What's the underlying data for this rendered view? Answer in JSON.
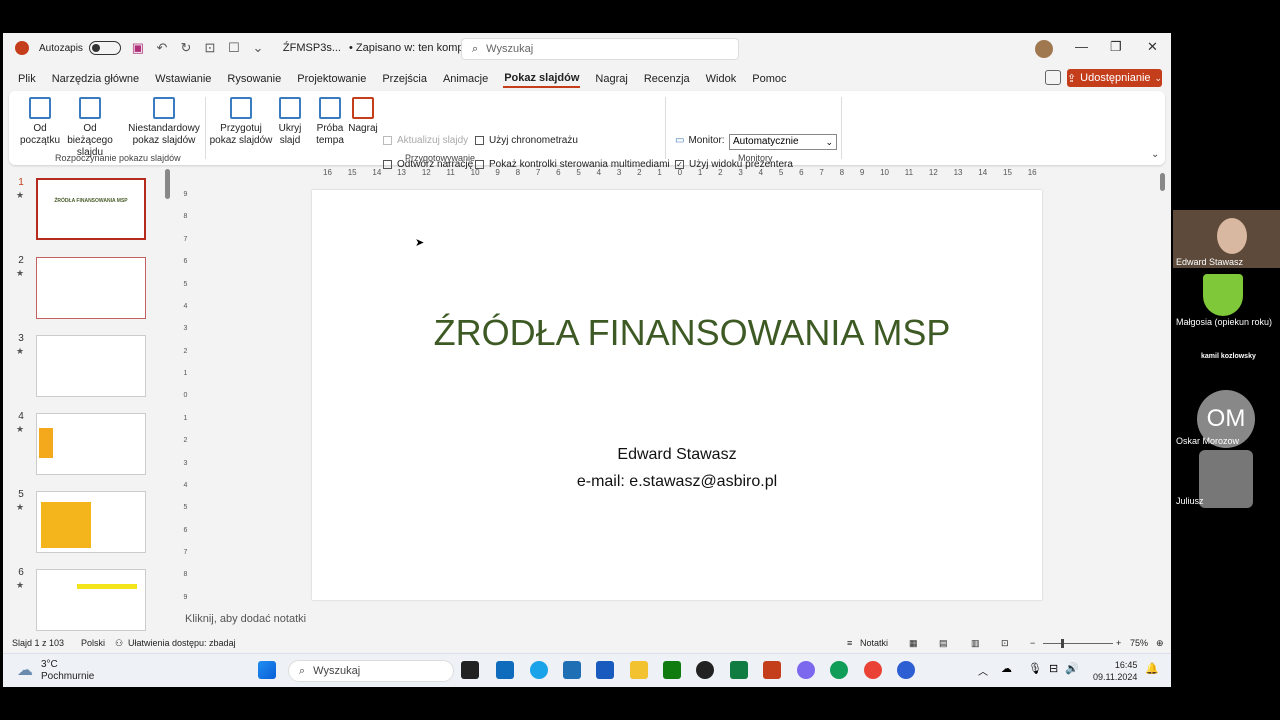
{
  "titlebar": {
    "autosave_label": "Autozapis",
    "doc_title": "ŹFMSP3s...",
    "save_status": "• Zapisano w: ten komputer",
    "search_placeholder": "Wyszukaj"
  },
  "tabs": [
    "Plik",
    "Narzędzia główne",
    "Wstawianie",
    "Rysowanie",
    "Projektowanie",
    "Przejścia",
    "Animacje",
    "Pokaz slajdów",
    "Nagraj",
    "Recenzja",
    "Widok",
    "Pomoc"
  ],
  "share_label": "Udostępnianie",
  "ribbon": {
    "from_start": "Od początku",
    "from_current": "Od bieżącego slajdu",
    "custom_show": "Niestandardowy pokaz slajdów",
    "group_start": "Rozpoczynanie pokazu slajdów",
    "setup": "Przygotuj pokaz slajdów",
    "hide": "Ukryj slajd",
    "rehearse": "Próba tempa",
    "record": "Nagraj",
    "update_slides": "Aktualizuj slajdy",
    "play_narration": "Odtwórz narrację",
    "use_timings": "Użyj chronometrażu",
    "show_media_controls": "Pokaż kontrolki sterowania multimediami",
    "group_setup": "Przygotowywanie",
    "monitor_label": "Monitor:",
    "monitor_value": "Automatycznie",
    "presenter_view": "Użyj widoku prezentera",
    "group_monitors": "Monitory"
  },
  "thumbnails": [
    "1",
    "2",
    "3",
    "4",
    "5",
    "6"
  ],
  "thumb1_title": "ŹRÓDŁA FINANSOWANIA MSP",
  "ruler_h": [
    "16",
    "15",
    "14",
    "13",
    "12",
    "11",
    "10",
    "9",
    "8",
    "7",
    "6",
    "5",
    "4",
    "3",
    "2",
    "1",
    "0",
    "1",
    "2",
    "3",
    "4",
    "5",
    "6",
    "7",
    "8",
    "9",
    "10",
    "11",
    "12",
    "13",
    "14",
    "15",
    "16"
  ],
  "ruler_v": [
    "9",
    "8",
    "7",
    "6",
    "5",
    "4",
    "3",
    "2",
    "1",
    "0",
    "1",
    "2",
    "3",
    "4",
    "5",
    "6",
    "7",
    "8",
    "9"
  ],
  "slide": {
    "title": "ŹRÓDŁA FINANSOWANIA MSP",
    "author": "Edward Stawasz",
    "email": "e-mail: e.stawasz@asbiro.pl"
  },
  "notes_placeholder": "Kliknij, aby dodać notatki",
  "status": {
    "slide_count": "Slajd 1 z 103",
    "language": "Polski",
    "accessibility": "Ułatwienia dostępu: zbadaj",
    "notes": "Notatki",
    "zoom": "75%"
  },
  "taskbar": {
    "temp": "3°C",
    "weather": "Pochmurnie",
    "search": "Wyszukaj",
    "time": "16:45",
    "date": "09.11.2024"
  },
  "participants": [
    "Edward Stawasz",
    "Małgosia (opiekun roku)",
    "kamil kozlowsky",
    "Oskar Morozow",
    "Juliusz"
  ],
  "participant_initials": "OM"
}
